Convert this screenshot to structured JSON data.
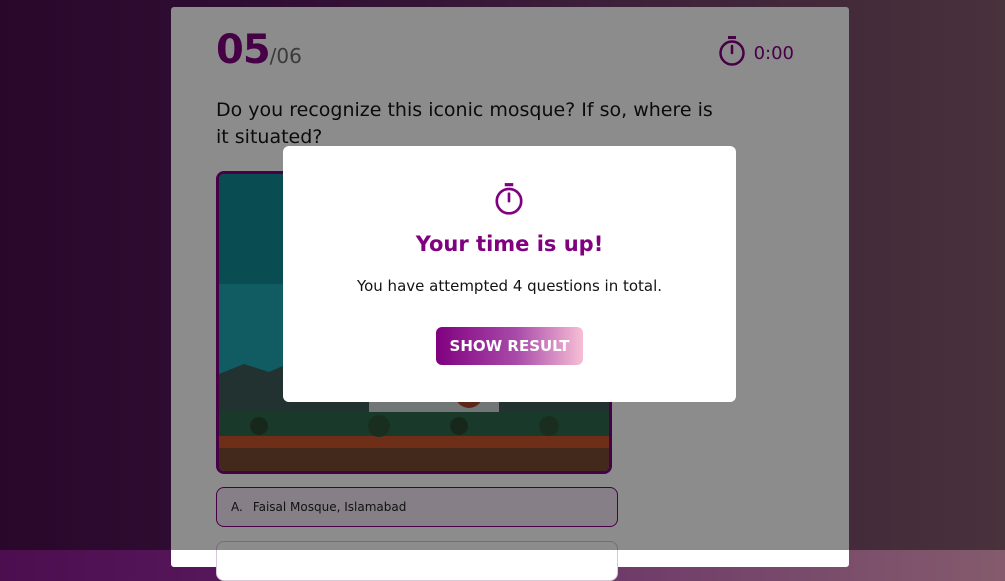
{
  "quiz": {
    "current_question": "05",
    "total_questions": "/06",
    "timer": "0:00",
    "question_text": "Do you recognize this iconic mosque? If so, where is it situated?",
    "options": [
      {
        "letter": "A.",
        "text": "Faisal Mosque, Islamabad"
      }
    ]
  },
  "modal": {
    "icon": "stopwatch-icon",
    "title": "Your time is up!",
    "message": "You have attempted 4 questions in total.",
    "button_label": "SHOW RESULT"
  },
  "colors": {
    "accent": "#800080",
    "button_gradient_end": "#f7bfd6",
    "background_left": "#4c0e4f",
    "background_right": "#845b6c"
  }
}
